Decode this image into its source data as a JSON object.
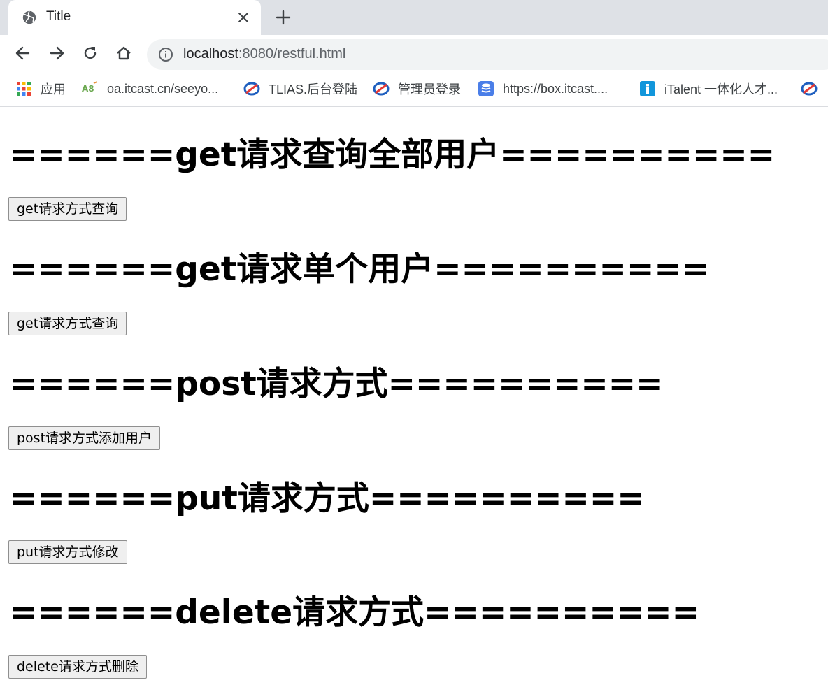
{
  "browser": {
    "tab": {
      "title": "Title"
    },
    "address": {
      "host": "localhost",
      "rest": ":8080/restful.html"
    },
    "bookmarks": [
      {
        "label": "应用",
        "icon": "apps-grid-icon"
      },
      {
        "label": "oa.itcast.cn/seeyo...",
        "icon": "seeyon-logo-icon"
      },
      {
        "label": "TLIAS.后台登陆",
        "icon": "tlias-logo-icon"
      },
      {
        "label": "管理员登录",
        "icon": "tlias-logo-icon"
      },
      {
        "label": "https://box.itcast....",
        "icon": "box-database-icon"
      },
      {
        "label": "iTalent 一体化人才...",
        "icon": "italent-info-icon"
      }
    ]
  },
  "page": {
    "sections": [
      {
        "heading": "======get请求查询全部用户==========",
        "button": "get请求方式查询"
      },
      {
        "heading": "======get请求单个用户==========",
        "button": "get请求方式查询"
      },
      {
        "heading": "======post请求方式==========",
        "button": "post请求方式添加用户"
      },
      {
        "heading": "======put请求方式==========",
        "button": "put请求方式修改"
      },
      {
        "heading": "======delete请求方式==========",
        "button": "delete请求方式删除"
      }
    ]
  }
}
